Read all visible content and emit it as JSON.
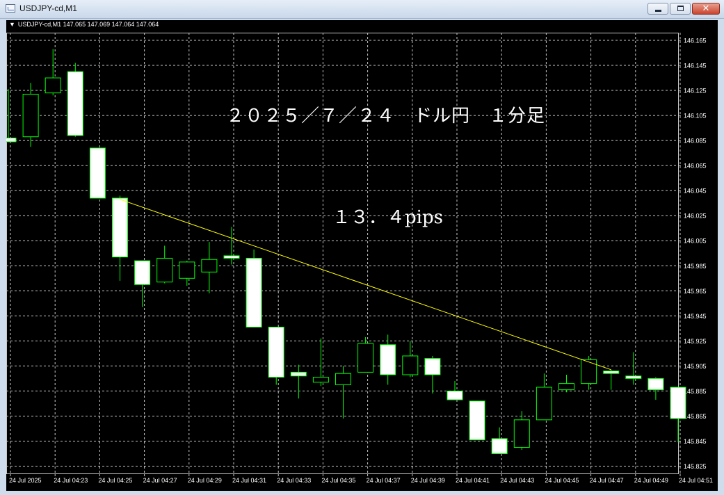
{
  "window": {
    "title": "USDJPY-cd,M1",
    "buttons": {
      "minimize": "minimize",
      "maximize": "maximize",
      "close": "✕"
    }
  },
  "chart_header": {
    "arrow": "▼",
    "text": "USDJPY-cd,M1  147.065 147.069 147.064 147.064"
  },
  "annotations": {
    "date_label": "２０２５／７／２４　ドル円　１分足",
    "pips_label": "１３．４pips"
  },
  "colors": {
    "background": "#000000",
    "grid": "#c8c8c8",
    "candle_bear_fill": "#ffffff",
    "candle_outline": "#00ff00",
    "trendline": "#ffff00",
    "axis_text": "#ffffff"
  },
  "chart_data": {
    "type": "candlestick",
    "symbol": "USDJPY-cd",
    "timeframe": "M1",
    "y_ticks": [
      "146.165",
      "146.145",
      "146.125",
      "146.105",
      "146.085",
      "146.065",
      "146.045",
      "146.025",
      "146.005",
      "145.985",
      "145.965",
      "145.945",
      "145.925",
      "145.905",
      "145.885",
      "145.865",
      "145.845",
      "145.825"
    ],
    "x_ticks": [
      "24 Jul 2025",
      "24 Jul 04:23",
      "24 Jul 04:25",
      "24 Jul 04:27",
      "24 Jul 04:29",
      "24 Jul 04:31",
      "24 Jul 04:33",
      "24 Jul 04:35",
      "24 Jul 04:37",
      "24 Jul 04:39",
      "24 Jul 04:41",
      "24 Jul 04:43",
      "24 Jul 04:45",
      "24 Jul 04:47",
      "24 Jul 04:49",
      "24 Jul 04:51"
    ],
    "ylim": [
      145.818,
      146.177
    ],
    "grid": true,
    "candles": [
      {
        "o": 146.087,
        "h": 146.126,
        "l": 146.086,
        "c": 146.084
      },
      {
        "o": 146.088,
        "h": 146.131,
        "l": 146.08,
        "c": 146.122
      },
      {
        "o": 146.123,
        "h": 146.158,
        "l": 146.121,
        "c": 146.135
      },
      {
        "o": 146.14,
        "h": 146.147,
        "l": 146.088,
        "c": 146.089
      },
      {
        "o": 146.079,
        "h": 146.079,
        "l": 146.039,
        "c": 146.039
      },
      {
        "o": 146.039,
        "h": 146.041,
        "l": 145.973,
        "c": 145.992
      },
      {
        "o": 145.989,
        "h": 145.989,
        "l": 145.952,
        "c": 145.97
      },
      {
        "o": 145.972,
        "h": 146.001,
        "l": 145.971,
        "c": 145.991
      },
      {
        "o": 145.975,
        "h": 145.989,
        "l": 145.969,
        "c": 145.988
      },
      {
        "o": 145.98,
        "h": 146.004,
        "l": 145.963,
        "c": 145.99
      },
      {
        "o": 145.993,
        "h": 146.016,
        "l": 145.986,
        "c": 145.991
      },
      {
        "o": 145.991,
        "h": 145.998,
        "l": 145.936,
        "c": 145.936
      },
      {
        "o": 145.936,
        "h": 145.936,
        "l": 145.89,
        "c": 145.896
      },
      {
        "o": 145.9,
        "h": 145.906,
        "l": 145.879,
        "c": 145.897
      },
      {
        "o": 145.892,
        "h": 145.927,
        "l": 145.889,
        "c": 145.896
      },
      {
        "o": 145.89,
        "h": 145.905,
        "l": 145.863,
        "c": 145.899
      },
      {
        "o": 145.9,
        "h": 145.928,
        "l": 145.9,
        "c": 145.923
      },
      {
        "o": 145.922,
        "h": 145.93,
        "l": 145.89,
        "c": 145.898
      },
      {
        "o": 145.898,
        "h": 145.925,
        "l": 145.896,
        "c": 145.913
      },
      {
        "o": 145.911,
        "h": 145.913,
        "l": 145.883,
        "c": 145.898
      },
      {
        "o": 145.885,
        "h": 145.893,
        "l": 145.878,
        "c": 145.878
      },
      {
        "o": 145.877,
        "h": 145.877,
        "l": 145.846,
        "c": 145.846
      },
      {
        "o": 145.847,
        "h": 145.856,
        "l": 145.835,
        "c": 145.835
      },
      {
        "o": 145.84,
        "h": 145.869,
        "l": 145.838,
        "c": 145.862
      },
      {
        "o": 145.862,
        "h": 145.899,
        "l": 145.862,
        "c": 145.888
      },
      {
        "o": 145.886,
        "h": 145.898,
        "l": 145.884,
        "c": 145.891
      },
      {
        "o": 145.891,
        "h": 145.913,
        "l": 145.886,
        "c": 145.91
      },
      {
        "o": 145.901,
        "h": 145.902,
        "l": 145.886,
        "c": 145.899
      },
      {
        "o": 145.897,
        "h": 145.916,
        "l": 145.89,
        "c": 145.895
      },
      {
        "o": 145.895,
        "h": 145.896,
        "l": 145.878,
        "c": 145.886
      },
      {
        "o": 145.888,
        "h": 145.888,
        "l": 145.844,
        "c": 145.863
      }
    ],
    "trendline": {
      "from": {
        "candle": 5,
        "price": 146.038
      },
      "to": {
        "candle": 27,
        "price": 145.902
      }
    }
  }
}
